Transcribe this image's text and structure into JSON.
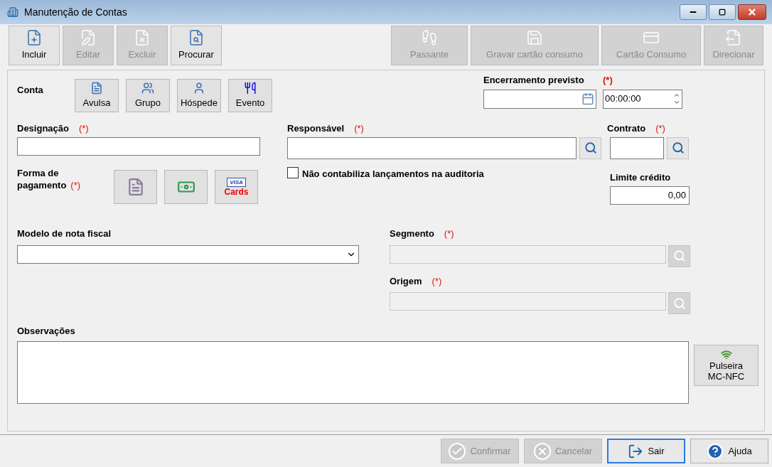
{
  "window": {
    "title": "Manutenção de Contas"
  },
  "toolbar": {
    "left": [
      {
        "label": "Incluir",
        "disabled": false
      },
      {
        "label": "Editar",
        "disabled": true
      },
      {
        "label": "Excluir",
        "disabled": true
      },
      {
        "label": "Procurar",
        "disabled": false
      }
    ],
    "right": [
      {
        "label": "Passante",
        "disabled": true
      },
      {
        "label": "Gravar cartão consumo",
        "disabled": true
      },
      {
        "label": "Cartão Consumo",
        "disabled": true
      },
      {
        "label": "Direcionar",
        "disabled": true
      }
    ]
  },
  "conta": {
    "label": "Conta",
    "options": [
      {
        "label": "Avulsa"
      },
      {
        "label": "Grupo"
      },
      {
        "label": "Hóspede"
      },
      {
        "label": "Evento"
      }
    ]
  },
  "encerramento": {
    "label": "Encerramento previsto",
    "required_mark": "(*)",
    "time": "00:00:00"
  },
  "designacao": {
    "label": "Designação",
    "required_mark": "(*)"
  },
  "responsavel": {
    "label": "Responsável",
    "required_mark": "(*)"
  },
  "contrato": {
    "label": "Contrato",
    "required_mark": "(*)"
  },
  "forma_pagamento": {
    "label_lines": [
      "Forma de",
      "pagamento"
    ],
    "required_mark": "(*)",
    "options": [
      {
        "kind": "invoice"
      },
      {
        "kind": "cash"
      },
      {
        "kind": "card",
        "label": "Cards",
        "brand": "VISA"
      }
    ]
  },
  "nao_contabiliza": {
    "label": "Não contabiliza lançamentos na auditoria",
    "checked": false
  },
  "limite_credito": {
    "label": "Limite crédito",
    "value": "0,00"
  },
  "modelo_nota": {
    "label": "Modelo de nota fiscal"
  },
  "segmento": {
    "label": "Segmento",
    "required_mark": "(*)",
    "disabled": true
  },
  "origem": {
    "label": "Origem",
    "required_mark": "(*)",
    "disabled": true
  },
  "observacoes": {
    "label": "Observações"
  },
  "pulseira": {
    "lines": [
      "Pulseira",
      "MC-NFC"
    ]
  },
  "footer": [
    {
      "label": "Confirmar",
      "disabled": true,
      "focused": false
    },
    {
      "label": "Cancelar",
      "disabled": true,
      "focused": false
    },
    {
      "label": "Sair",
      "disabled": false,
      "focused": true
    },
    {
      "label": "Ajuda",
      "disabled": false,
      "focused": false
    }
  ]
}
